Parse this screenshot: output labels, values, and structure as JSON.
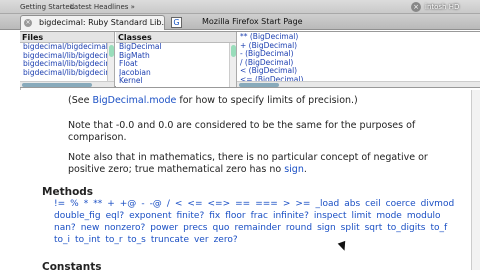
{
  "bookmarks": {
    "items": [
      "Getting Started",
      "Latest Headlines »"
    ],
    "desktop_label": "intosh HD"
  },
  "tabs": [
    {
      "label": "bigdecimal: Ruby Standard Lib..."
    },
    {
      "label": "Mozilla Firefox Start Page"
    }
  ],
  "frames": {
    "files": {
      "header": "Files",
      "items": [
        "bigdecimal/bigdecimal",
        "bigdecimal/lib/bigdecim",
        "bigdecimal/lib/bigdecim",
        "bigdecimal/lib/bigdecim"
      ]
    },
    "classes": {
      "header": "Classes",
      "items": [
        "BigDecimal",
        "BigMath",
        "Float",
        "Jacobian",
        "Kernel"
      ]
    },
    "methods": {
      "items": [
        "** (BigDecimal)",
        "+ (BigDecimal)",
        "- (BigDecimal)",
        "/ (BigDecimal)",
        "< (BigDecimal)",
        "<= (BigDecimal)"
      ]
    }
  },
  "content": {
    "p1_pre": "(See ",
    "p1_link": "BigDecimal.mode",
    "p1_post": " for how to specify limits of precision.)",
    "p2": "Note that -0.0 and 0.0 are considered to be the same for the purposes of comparison.",
    "p3_pre": "Note also that in mathematics, there is no particular concept of negative or positive zero; true mathematical zero has no ",
    "p3_link": "sign",
    "p3_post": ".",
    "methods_heading": "Methods",
    "methods": [
      "!=",
      "%",
      "*",
      "**",
      "+",
      "+@",
      "-",
      "-@",
      "/",
      "<",
      "<=",
      "<=>",
      "==",
      "===",
      ">",
      ">=",
      "_load",
      "abs",
      "ceil",
      "coerce",
      "divmod",
      "double_fig",
      "eql?",
      "exponent",
      "finite?",
      "fix",
      "floor",
      "frac",
      "infinite?",
      "inspect",
      "limit",
      "mode",
      "modulo",
      "nan?",
      "new",
      "nonzero?",
      "power",
      "precs",
      "quo",
      "remainder",
      "round",
      "sign",
      "split",
      "sqrt",
      "to_digits",
      "to_f",
      "to_i",
      "to_int",
      "to_r",
      "to_s",
      "truncate",
      "ver",
      "zero?"
    ],
    "constants_heading": "Constants"
  }
}
